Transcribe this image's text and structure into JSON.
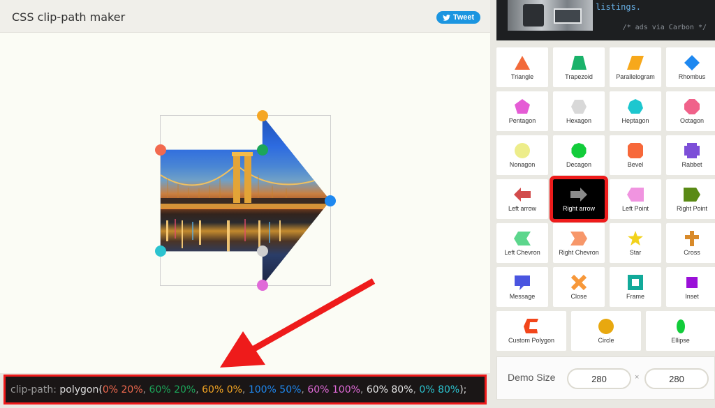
{
  "header": {
    "title": "CSS clip-path maker",
    "tweet_label": "Tweet"
  },
  "ad": {
    "text": "listings.",
    "via": "/* ads via Carbon */"
  },
  "code": {
    "property": "clip-path:",
    "function": "polygon(",
    "points": [
      "0% 20%",
      "60% 20%",
      "60% 0%",
      "100% 50%",
      "60% 100%",
      "60% 80%",
      "0% 80%"
    ],
    "close": ");"
  },
  "shapes": [
    {
      "label": "Triangle",
      "icon": "triangle-icon",
      "color": "#f26a3a"
    },
    {
      "label": "Trapezoid",
      "icon": "trapezoid-icon",
      "color": "#1ab26a"
    },
    {
      "label": "Parallelogram",
      "icon": "parallelogram-icon",
      "color": "#f7a81b"
    },
    {
      "label": "Rhombus",
      "icon": "rhombus-icon",
      "color": "#1e88f0"
    },
    {
      "label": "Pentagon",
      "icon": "pentagon-icon",
      "color": "#e55cd5"
    },
    {
      "label": "Hexagon",
      "icon": "hexagon-icon",
      "color": "#d8d8d8"
    },
    {
      "label": "Heptagon",
      "icon": "heptagon-icon",
      "color": "#1dc7cf"
    },
    {
      "label": "Octagon",
      "icon": "octagon-icon",
      "color": "#f0628a"
    },
    {
      "label": "Nonagon",
      "icon": "nonagon-icon",
      "color": "#eded8a"
    },
    {
      "label": "Decagon",
      "icon": "decagon-icon",
      "color": "#12cc3a"
    },
    {
      "label": "Bevel",
      "icon": "bevel-icon",
      "color": "#f7683a"
    },
    {
      "label": "Rabbet",
      "icon": "rabbet-icon",
      "color": "#7d4fd8"
    },
    {
      "label": "Left arrow",
      "icon": "left-arrow-icon",
      "color": "#d24b4b"
    },
    {
      "label": "Right arrow",
      "icon": "right-arrow-icon",
      "color": "#8a8a8a"
    },
    {
      "label": "Left Point",
      "icon": "left-point-icon",
      "color": "#f094e0"
    },
    {
      "label": "Right Point",
      "icon": "right-point-icon",
      "color": "#5a8a15"
    },
    {
      "label": "Left Chevron",
      "icon": "left-chevron-icon",
      "color": "#5cd68c"
    },
    {
      "label": "Right Chevron",
      "icon": "right-chevron-icon",
      "color": "#f7976a"
    },
    {
      "label": "Star",
      "icon": "star-icon",
      "color": "#f2d21b"
    },
    {
      "label": "Cross",
      "icon": "cross-icon",
      "color": "#d88a2a"
    },
    {
      "label": "Message",
      "icon": "message-icon",
      "color": "#4a55e0"
    },
    {
      "label": "Close",
      "icon": "close-icon",
      "color": "#f7983a"
    },
    {
      "label": "Frame",
      "icon": "frame-icon",
      "color": "#12aa9a"
    },
    {
      "label": "Inset",
      "icon": "inset-icon",
      "color": "#9a10d8"
    },
    {
      "label": "Custom Polygon",
      "icon": "custom-polygon-icon",
      "color": "#f2461b"
    },
    {
      "label": "Circle",
      "icon": "circle-icon",
      "color": "#e8a80f"
    },
    {
      "label": "Ellipse",
      "icon": "ellipse-icon",
      "color": "#12cc3a"
    }
  ],
  "selected_shape": "Right arrow",
  "demo": {
    "label": "Demo Size",
    "width": "280",
    "times": "×",
    "height": "280"
  }
}
